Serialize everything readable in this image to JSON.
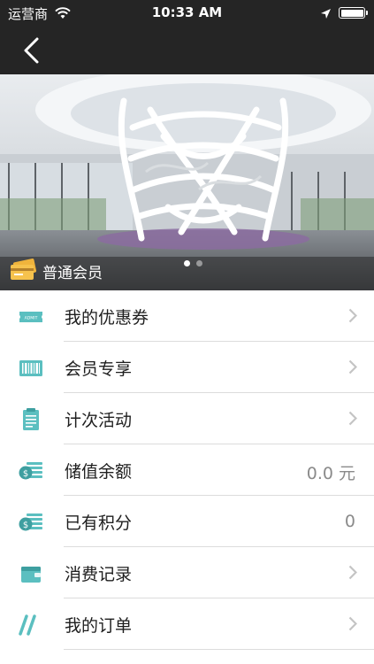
{
  "status_bar": {
    "carrier": "运营商",
    "time": "10:33 AM"
  },
  "banner": {
    "member_level": "普通会员",
    "page_count": 2,
    "active_page": 0
  },
  "menu": [
    {
      "label": "我的优惠券",
      "icon": "coupon-ticket-icon",
      "value": "",
      "chevron": true
    },
    {
      "label": "会员专享",
      "icon": "barcode-card-icon",
      "value": "",
      "chevron": true
    },
    {
      "label": "计次活动",
      "icon": "clipboard-icon",
      "value": "",
      "chevron": true
    },
    {
      "label": "储值余额",
      "icon": "coin-stack-icon",
      "value": "0.0 元",
      "chevron": false
    },
    {
      "label": "已有积分",
      "icon": "coin-stack-icon",
      "value": "0",
      "chevron": false
    },
    {
      "label": "消费记录",
      "icon": "wallet-icon",
      "value": "",
      "chevron": true
    },
    {
      "label": "我的订单",
      "icon": "slashes-icon",
      "value": "",
      "chevron": true
    }
  ],
  "colors": {
    "accent": "#5bbfc0",
    "bar": "#252525",
    "chevron": "#c4c4c4",
    "value_text": "#8a8a8a"
  }
}
